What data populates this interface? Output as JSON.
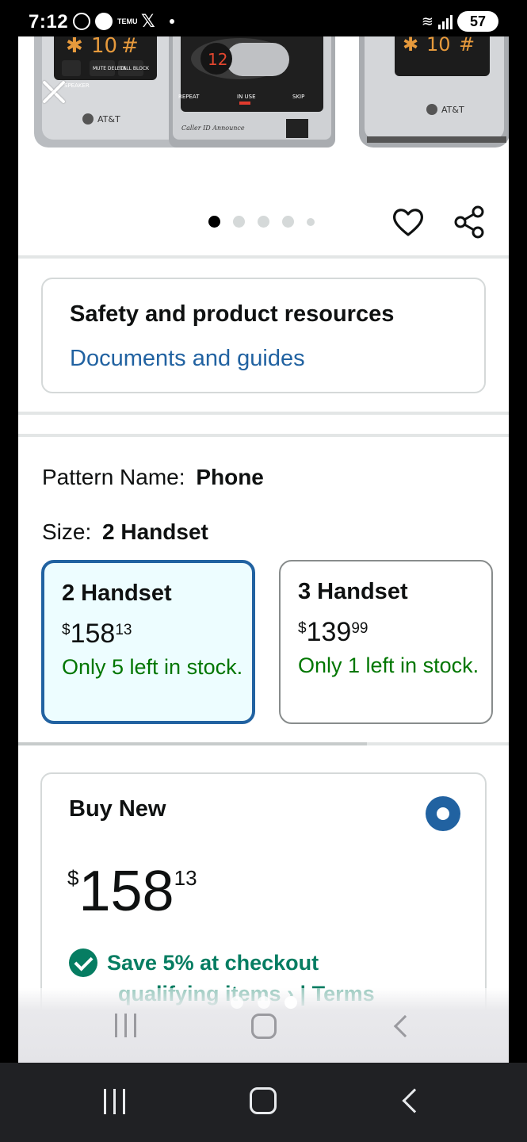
{
  "status_bar": {
    "time": "7:12",
    "temu_label": "TEMU",
    "battery": "57"
  },
  "product_image": {
    "brand_left": "AT&T",
    "brand_right": "AT&T",
    "display_number": "12",
    "repeat_label": "REPEAT",
    "in_use_label": "IN USE",
    "skip_label": "SKIP",
    "caller_id_label": "Caller ID Announce",
    "speaker_label": "SPEAKER",
    "mute_label": "MUTE DELETE",
    "call_block_label": "CALL BLOCK"
  },
  "carousel": {
    "total_dots": 5,
    "active_index": 0
  },
  "safety": {
    "title": "Safety and product resources",
    "link": "Documents and guides"
  },
  "variations": {
    "pattern_label": "Pattern Name:",
    "pattern_value": "Phone",
    "size_label": "Size:",
    "size_value": "2 Handset",
    "options": [
      {
        "name": "2 Handset",
        "currency": "$",
        "whole": "158",
        "fraction": "13",
        "stock": "Only 5 left in stock.",
        "selected": true
      },
      {
        "name": "3 Handset",
        "currency": "$",
        "whole": "139",
        "fraction": "99",
        "stock": "Only 1 left in stock.",
        "selected": false
      }
    ]
  },
  "buy_box": {
    "title": "Buy New",
    "currency": "$",
    "whole": "158",
    "fraction": "13",
    "savings": "Save 5% at checkout",
    "cutoff_text": "qualifying items ›  |  Terms"
  },
  "colors": {
    "link": "#2162a1",
    "stock_green": "#007600",
    "savings_green": "#067d62",
    "selected_bg": "#edfdff"
  }
}
